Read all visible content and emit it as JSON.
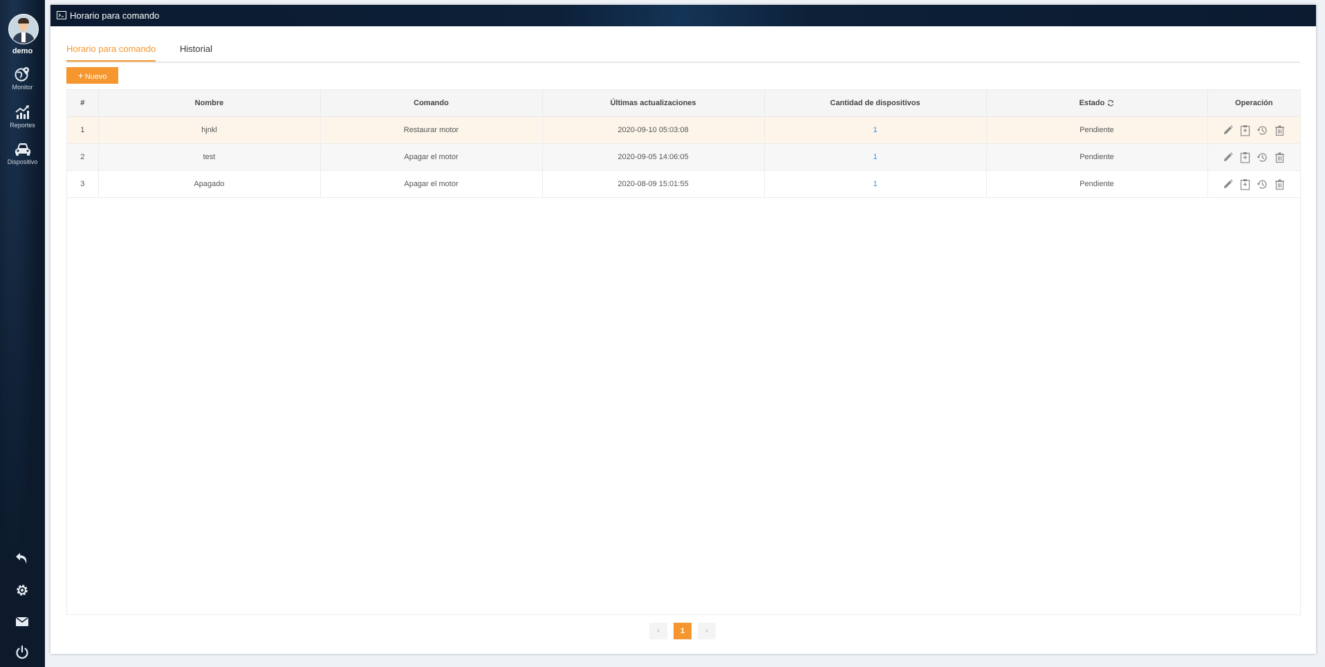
{
  "user": {
    "name": "demo"
  },
  "sidebar": {
    "items": [
      {
        "label": "Monitor",
        "icon": "globe-pin-icon"
      },
      {
        "label": "Reportes",
        "icon": "chart-up-icon"
      },
      {
        "label": "Dispositivo",
        "icon": "car-icon"
      }
    ],
    "bottom": [
      "back-icon",
      "gear-icon",
      "mail-icon",
      "power-icon"
    ]
  },
  "window": {
    "title": "Horario para comando"
  },
  "tabs": [
    {
      "label": "Horario para comando",
      "active": true
    },
    {
      "label": "Historial",
      "active": false
    }
  ],
  "toolbar": {
    "new_label": "Nuevo"
  },
  "table": {
    "columns": [
      "#",
      "Nombre",
      "Comando",
      "Últimas actualizaciones",
      "Cantidad de dispositivos",
      "Estado",
      "Operación"
    ],
    "rows": [
      {
        "n": "1",
        "nombre": "hjnkl",
        "comando": "Restaurar motor",
        "fecha": "2020-09-10 05:03:08",
        "cantidad": "1",
        "estado": "Pendiente"
      },
      {
        "n": "2",
        "nombre": "test",
        "comando": "Apagar el motor",
        "fecha": "2020-09-05 14:06:05",
        "cantidad": "1",
        "estado": "Pendiente"
      },
      {
        "n": "3",
        "nombre": "Apagado",
        "comando": "Apagar el motor",
        "fecha": "2020-08-09 15:01:55",
        "cantidad": "1",
        "estado": "Pendiente"
      }
    ]
  },
  "pagination": {
    "current": "1",
    "prev": "‹",
    "next": "›"
  },
  "colors": {
    "accent": "#f5962e",
    "sidebar": "#0c1a2c",
    "link": "#3a8ee6"
  }
}
